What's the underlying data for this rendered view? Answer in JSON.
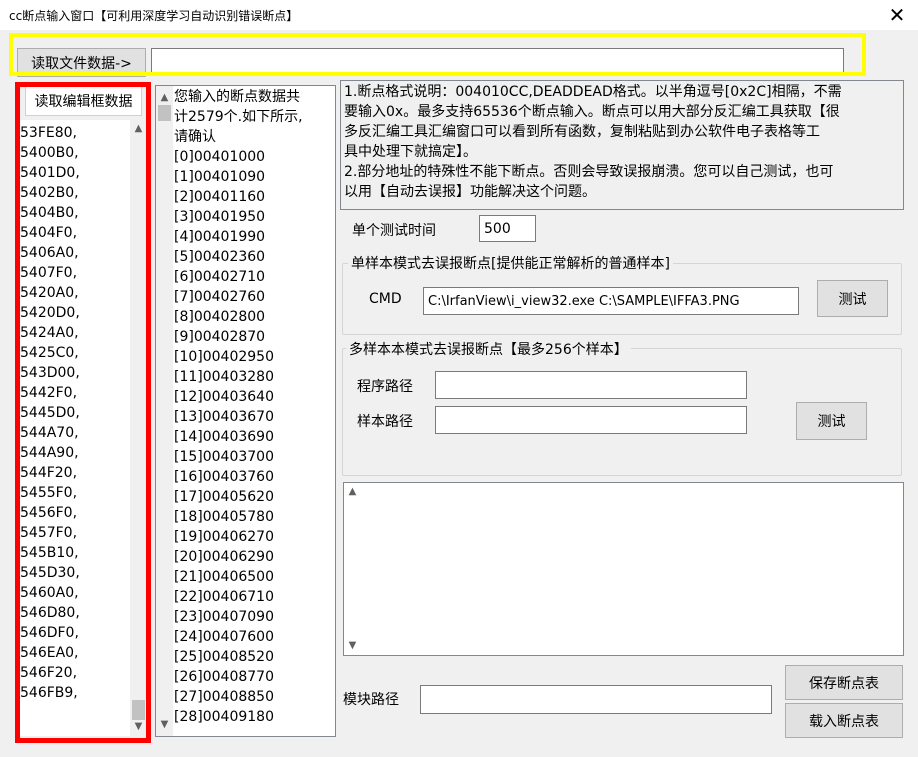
{
  "window": {
    "title": "cc断点输入窗口【可利用深度学习自动识别错误断点】",
    "close_glyph": "✕"
  },
  "top_bar": {
    "read_file_label": "读取文件数据->",
    "file_path_value": ""
  },
  "left_panel": {
    "read_editor_label": "读取编辑框数据",
    "entries": [
      "53FE80,",
      "5400B0,",
      "5401D0,",
      "5402B0,",
      "5404B0,",
      "5404F0,",
      "5406A0,",
      "5407F0,",
      "5420A0,",
      "5420D0,",
      "5424A0,",
      "5425C0,",
      "543D00,",
      "5442F0,",
      "5445D0,",
      "544A70,",
      "544A90,",
      "544F20,",
      "5455F0,",
      "5456F0,",
      "5457F0,",
      "545B10,",
      "545D30,",
      "5460A0,",
      "546D80,",
      "546DF0,",
      "546EA0,",
      "546F20,",
      "546FB9,"
    ]
  },
  "breakpoint_list": {
    "summary_lines": [
      "您输入的断点数据共",
      "计2579个.如下所示,",
      "请确认"
    ],
    "items": [
      "[0]00401000",
      "[1]00401090",
      "[2]00401160",
      "[3]00401950",
      "[4]00401990",
      "[5]00402360",
      "[6]00402710",
      "[7]00402760",
      "[8]00402800",
      "[9]00402870",
      "[10]00402950",
      "[11]00403280",
      "[12]00403640",
      "[13]00403670",
      "[14]00403690",
      "[15]00403700",
      "[16]00403760",
      "[17]00405620",
      "[18]00405780",
      "[19]00406270",
      "[20]00406290",
      "[21]00406500",
      "[22]00406710",
      "[23]00407090",
      "[24]00407600",
      "[25]00408520",
      "[26]00408770",
      "[27]00408850",
      "[28]00409180"
    ]
  },
  "info": {
    "lines": [
      "1.断点格式说明：004010CC,DEADDEAD格式。以半角逗号[0x2C]相隔，不需",
      "要输入0x。最多支持65536个断点输入。断点可以用大部分反汇编工具获取【很",
      "多反汇编工具汇编窗口可以看到所有函数，复制粘贴到办公软件电子表格等工",
      "具中处理下就搞定】。",
      "2.部分地址的特殊性不能下断点。否则会导致误报崩溃。您可以自己测试，也可",
      "以用【自动去误报】功能解决这个问题。"
    ]
  },
  "single_test": {
    "time_label": "单个测试时间",
    "time_value": "500"
  },
  "single_sample": {
    "group_title": "单样本模式去误报断点[提供能正常解析的普通样本]",
    "cmd_label": "CMD",
    "cmd_value": "C:\\IrfanView\\i_view32.exe C:\\SAMPLE\\IFFA3.PNG",
    "test_label": "测试"
  },
  "multi_sample": {
    "group_title": "多样本本模式去误报断点【最多256个样本】",
    "program_label": "程序路径",
    "program_value": "",
    "sample_label": "样本路径",
    "sample_value": "",
    "test_label": "测试"
  },
  "output": {
    "text": ""
  },
  "bottom": {
    "module_label": "模块路径",
    "module_value": "",
    "save_label": "保存断点表",
    "load_label": "载入断点表"
  }
}
